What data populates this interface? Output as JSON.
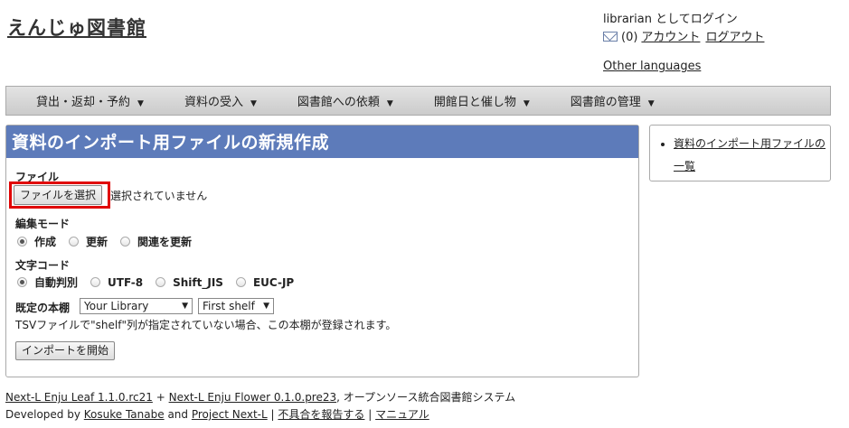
{
  "site": {
    "title": "えんじゅ図書館"
  },
  "user": {
    "login_text": "librarian としてログイン",
    "mail_count": "(0)",
    "account_link": "アカウント",
    "logout_link": "ログアウト",
    "other_languages": "Other languages"
  },
  "nav": {
    "items": [
      {
        "label": "貸出・返却・予約"
      },
      {
        "label": "資料の受入"
      },
      {
        "label": "図書館への依頼"
      },
      {
        "label": "開館日と催し物"
      },
      {
        "label": "図書館の管理"
      }
    ],
    "caret": "▼"
  },
  "form": {
    "heading": "資料のインポート用ファイルの新規作成",
    "file_label": "ファイル",
    "file_button": "ファイルを選択",
    "file_status": "選択されていません",
    "edit_mode_label": "編集モード",
    "edit_modes": [
      "作成",
      "更新",
      "関連を更新"
    ],
    "encoding_label": "文字コード",
    "encodings": [
      "自動判別",
      "UTF-8",
      "Shift_JIS",
      "EUC-JP"
    ],
    "shelf_label": "既定の本棚",
    "library_select": "Your Library",
    "shelf_select": "First shelf",
    "note": "TSVファイルで\"shelf\"列が指定されていない場合、この本棚が登録されます。",
    "submit_button": "インポートを開始"
  },
  "sidebar": {
    "link": "資料のインポート用ファイルの一覧"
  },
  "footer": {
    "leaf_link": "Next-L Enju Leaf 1.1.0.rc21",
    "plus": "+",
    "flower_link": "Next-L Enju Flower 0.1.0.pre23",
    "tagline": ", オープンソース統合図書館システム",
    "developed_by": "Developed by",
    "author_link": "Kosuke Tanabe",
    "and": "and",
    "project_link": "Project Next-L",
    "sep": "|",
    "report_link": "不具合を報告する",
    "manual_link": "マニュアル"
  },
  "colors": {
    "header_bg": "#5d7bba",
    "highlight": "#e00000"
  }
}
